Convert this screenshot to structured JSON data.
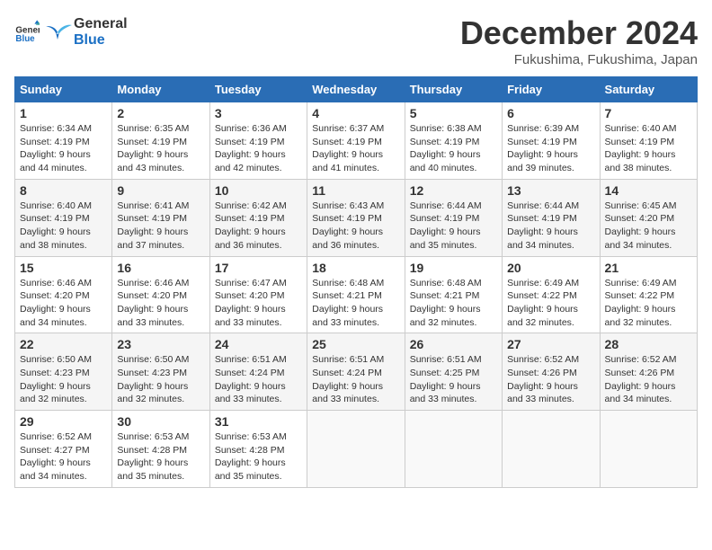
{
  "logo": {
    "text_general": "General",
    "text_blue": "Blue"
  },
  "header": {
    "month": "December 2024",
    "location": "Fukushima, Fukushima, Japan"
  },
  "weekdays": [
    "Sunday",
    "Monday",
    "Tuesday",
    "Wednesday",
    "Thursday",
    "Friday",
    "Saturday"
  ],
  "weeks": [
    [
      {
        "day": "1",
        "sunrise": "6:34 AM",
        "sunset": "4:19 PM",
        "daylight": "9 hours and 44 minutes."
      },
      {
        "day": "2",
        "sunrise": "6:35 AM",
        "sunset": "4:19 PM",
        "daylight": "9 hours and 43 minutes."
      },
      {
        "day": "3",
        "sunrise": "6:36 AM",
        "sunset": "4:19 PM",
        "daylight": "9 hours and 42 minutes."
      },
      {
        "day": "4",
        "sunrise": "6:37 AM",
        "sunset": "4:19 PM",
        "daylight": "9 hours and 41 minutes."
      },
      {
        "day": "5",
        "sunrise": "6:38 AM",
        "sunset": "4:19 PM",
        "daylight": "9 hours and 40 minutes."
      },
      {
        "day": "6",
        "sunrise": "6:39 AM",
        "sunset": "4:19 PM",
        "daylight": "9 hours and 39 minutes."
      },
      {
        "day": "7",
        "sunrise": "6:40 AM",
        "sunset": "4:19 PM",
        "daylight": "9 hours and 38 minutes."
      }
    ],
    [
      {
        "day": "8",
        "sunrise": "6:40 AM",
        "sunset": "4:19 PM",
        "daylight": "9 hours and 38 minutes."
      },
      {
        "day": "9",
        "sunrise": "6:41 AM",
        "sunset": "4:19 PM",
        "daylight": "9 hours and 37 minutes."
      },
      {
        "day": "10",
        "sunrise": "6:42 AM",
        "sunset": "4:19 PM",
        "daylight": "9 hours and 36 minutes."
      },
      {
        "day": "11",
        "sunrise": "6:43 AM",
        "sunset": "4:19 PM",
        "daylight": "9 hours and 36 minutes."
      },
      {
        "day": "12",
        "sunrise": "6:44 AM",
        "sunset": "4:19 PM",
        "daylight": "9 hours and 35 minutes."
      },
      {
        "day": "13",
        "sunrise": "6:44 AM",
        "sunset": "4:19 PM",
        "daylight": "9 hours and 34 minutes."
      },
      {
        "day": "14",
        "sunrise": "6:45 AM",
        "sunset": "4:20 PM",
        "daylight": "9 hours and 34 minutes."
      }
    ],
    [
      {
        "day": "15",
        "sunrise": "6:46 AM",
        "sunset": "4:20 PM",
        "daylight": "9 hours and 34 minutes."
      },
      {
        "day": "16",
        "sunrise": "6:46 AM",
        "sunset": "4:20 PM",
        "daylight": "9 hours and 33 minutes."
      },
      {
        "day": "17",
        "sunrise": "6:47 AM",
        "sunset": "4:20 PM",
        "daylight": "9 hours and 33 minutes."
      },
      {
        "day": "18",
        "sunrise": "6:48 AM",
        "sunset": "4:21 PM",
        "daylight": "9 hours and 33 minutes."
      },
      {
        "day": "19",
        "sunrise": "6:48 AM",
        "sunset": "4:21 PM",
        "daylight": "9 hours and 32 minutes."
      },
      {
        "day": "20",
        "sunrise": "6:49 AM",
        "sunset": "4:22 PM",
        "daylight": "9 hours and 32 minutes."
      },
      {
        "day": "21",
        "sunrise": "6:49 AM",
        "sunset": "4:22 PM",
        "daylight": "9 hours and 32 minutes."
      }
    ],
    [
      {
        "day": "22",
        "sunrise": "6:50 AM",
        "sunset": "4:23 PM",
        "daylight": "9 hours and 32 minutes."
      },
      {
        "day": "23",
        "sunrise": "6:50 AM",
        "sunset": "4:23 PM",
        "daylight": "9 hours and 32 minutes."
      },
      {
        "day": "24",
        "sunrise": "6:51 AM",
        "sunset": "4:24 PM",
        "daylight": "9 hours and 33 minutes."
      },
      {
        "day": "25",
        "sunrise": "6:51 AM",
        "sunset": "4:24 PM",
        "daylight": "9 hours and 33 minutes."
      },
      {
        "day": "26",
        "sunrise": "6:51 AM",
        "sunset": "4:25 PM",
        "daylight": "9 hours and 33 minutes."
      },
      {
        "day": "27",
        "sunrise": "6:52 AM",
        "sunset": "4:26 PM",
        "daylight": "9 hours and 33 minutes."
      },
      {
        "day": "28",
        "sunrise": "6:52 AM",
        "sunset": "4:26 PM",
        "daylight": "9 hours and 34 minutes."
      }
    ],
    [
      {
        "day": "29",
        "sunrise": "6:52 AM",
        "sunset": "4:27 PM",
        "daylight": "9 hours and 34 minutes."
      },
      {
        "day": "30",
        "sunrise": "6:53 AM",
        "sunset": "4:28 PM",
        "daylight": "9 hours and 35 minutes."
      },
      {
        "day": "31",
        "sunrise": "6:53 AM",
        "sunset": "4:28 PM",
        "daylight": "9 hours and 35 minutes."
      },
      null,
      null,
      null,
      null
    ]
  ]
}
